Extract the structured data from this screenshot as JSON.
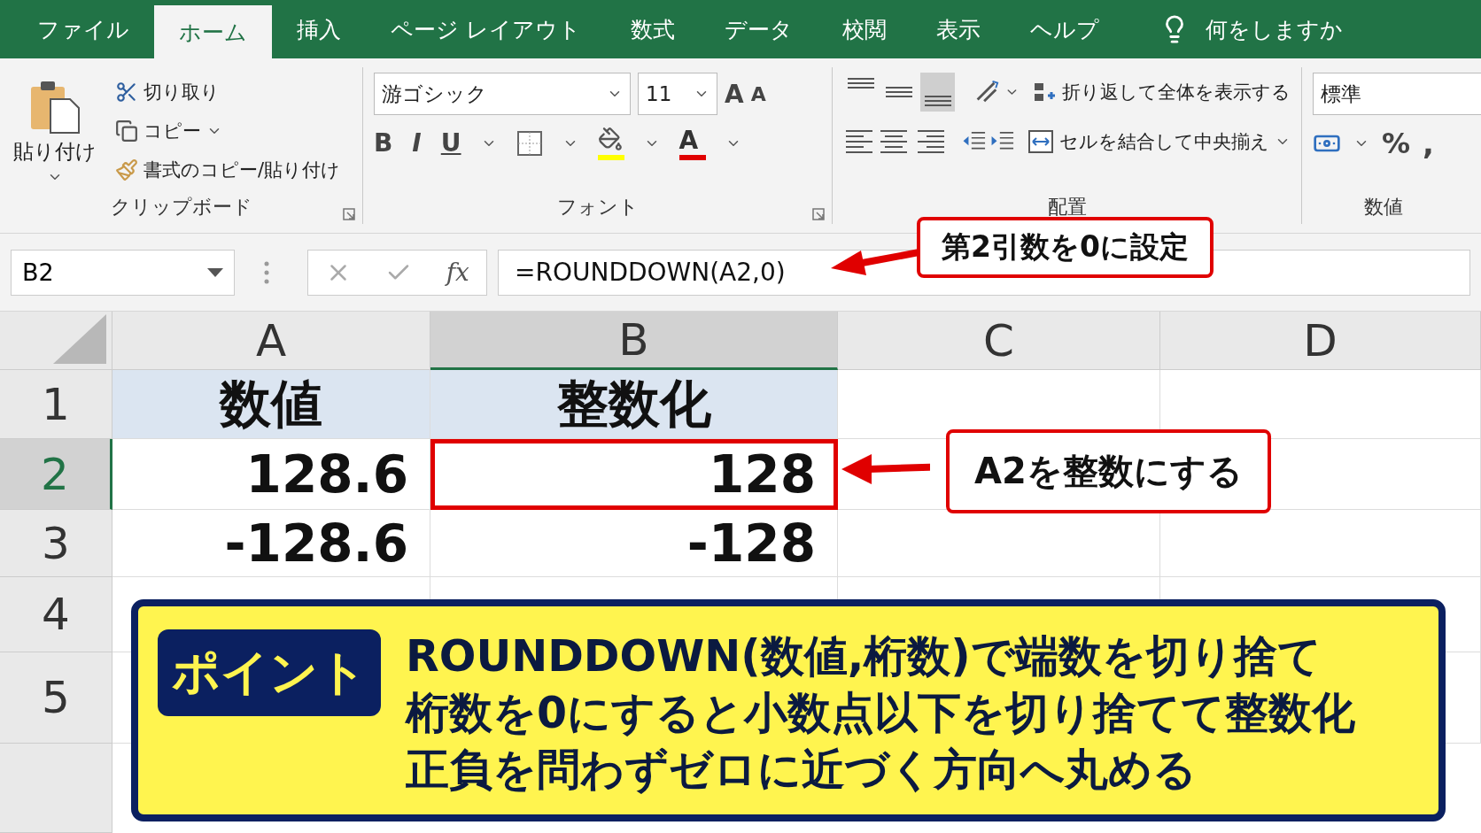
{
  "ribbon_tabs": [
    {
      "label": "ファイル",
      "selected": false
    },
    {
      "label": "ホーム",
      "selected": true
    },
    {
      "label": "挿入",
      "selected": false
    },
    {
      "label": "ページ レイアウト",
      "selected": false
    },
    {
      "label": "数式",
      "selected": false
    },
    {
      "label": "データ",
      "selected": false
    },
    {
      "label": "校閲",
      "selected": false
    },
    {
      "label": "表示",
      "selected": false
    },
    {
      "label": "ヘルプ",
      "selected": false
    }
  ],
  "tell_me": {
    "placeholder": "何をしますか"
  },
  "ribbon": {
    "clipboard": {
      "paste": "貼り付け",
      "cut": "切り取り",
      "copy": "コピー",
      "format_painter": "書式のコピー/貼り付け",
      "label": "クリップボード"
    },
    "font": {
      "name": "游ゴシック",
      "size": "11",
      "grow": "A",
      "shrink": "A",
      "bold": "B",
      "italic": "I",
      "underline": "U",
      "font_color": "A",
      "label": "フォント"
    },
    "alignment": {
      "vertical": [
        {
          "selected": false
        },
        {
          "selected": false
        },
        {
          "selected": true
        }
      ],
      "wrap": "折り返して全体を表示する",
      "merge": "セルを結合して中央揃え",
      "label": "配置"
    },
    "number": {
      "format": "標準",
      "percent": "%",
      "comma": ",",
      "label": "数値"
    }
  },
  "formula_bar": {
    "name_box": "B2",
    "fx": "fx",
    "formula": "=ROUNDDOWN(A2,0)"
  },
  "sheet": {
    "columns": [
      {
        "label": "A",
        "selected": false
      },
      {
        "label": "B",
        "selected": true
      },
      {
        "label": "C",
        "selected": false
      },
      {
        "label": "D",
        "selected": false
      }
    ],
    "rows": [
      {
        "label": "1",
        "selected": false,
        "kind": "heading",
        "cells": [
          "数値",
          "整数化"
        ]
      },
      {
        "label": "2",
        "selected": true,
        "kind": "value",
        "cells": [
          "128.6",
          "128"
        ]
      },
      {
        "label": "3",
        "selected": false,
        "kind": "value",
        "cells": [
          "-128.6",
          "-128"
        ]
      },
      {
        "label": "4",
        "selected": false
      },
      {
        "label": "5",
        "selected": false
      }
    ]
  },
  "callouts": [
    {
      "kind": "formula",
      "text": "第2引数を0に設定"
    },
    {
      "kind": "cell",
      "text": "A2を整数にする"
    }
  ],
  "point": {
    "badge": "ポイント",
    "lines": [
      "ROUNDDOWN(数値,桁数)で端数を切り捨て",
      "桁数を0にすると小数点以下を切り捨てて整数化",
      "正負を問わずゼロに近づく方向へ丸める"
    ]
  }
}
